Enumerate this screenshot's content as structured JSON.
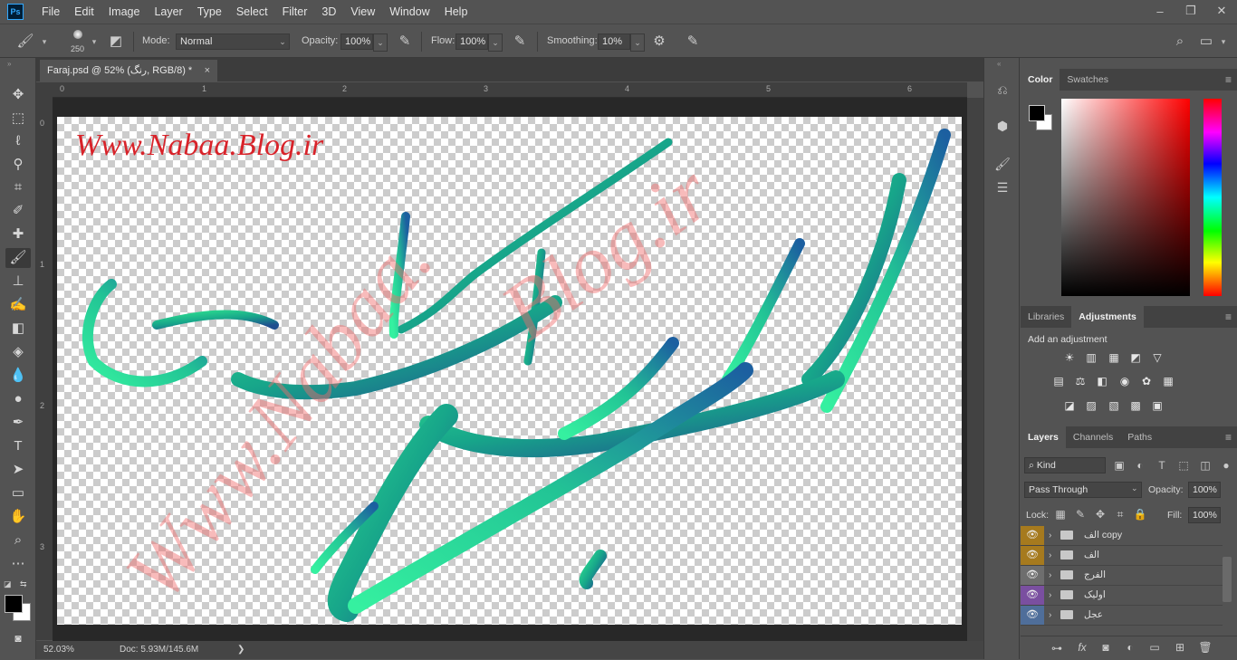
{
  "app": {
    "logo": "Ps"
  },
  "menu": [
    "File",
    "Edit",
    "Image",
    "Layer",
    "Type",
    "Select",
    "Filter",
    "3D",
    "View",
    "Window",
    "Help"
  ],
  "window_controls": {
    "minimize": "–",
    "restore": "❐",
    "close": "✕"
  },
  "options": {
    "brush_size": "250",
    "mode_label": "Mode:",
    "mode_value": "Normal",
    "opacity_label": "Opacity:",
    "opacity_value": "100%",
    "flow_label": "Flow:",
    "flow_value": "100%",
    "smoothing_label": "Smoothing:",
    "smoothing_value": "10%"
  },
  "document": {
    "tab_title": "Faraj.psd @ 52% (رنگ, RGB/8) *",
    "close": "×",
    "ruler_top": [
      "0",
      "1",
      "2",
      "3",
      "4",
      "5",
      "6"
    ],
    "ruler_left": [
      "0",
      "1",
      "2",
      "3"
    ],
    "watermark_top": "Www.Nabaa.Blog.ir",
    "watermark_diag1": "Www.Nabaa.",
    "watermark_diag2": "Blog.ir"
  },
  "status": {
    "zoom": "52.03%",
    "doc_info": "Doc: 5.93M/145.6M",
    "arrow": "❯"
  },
  "color_panel": {
    "tabs": [
      "Color",
      "Swatches"
    ],
    "foreground": "#000000",
    "background": "#ffffff"
  },
  "adjustments_panel": {
    "tabs": [
      "Libraries",
      "Adjustments"
    ],
    "heading": "Add an adjustment"
  },
  "layers_panel": {
    "tabs": [
      "Layers",
      "Channels",
      "Paths"
    ],
    "filter_kind": "Kind",
    "blend_mode": "Pass Through",
    "opacity_label": "Opacity:",
    "opacity_value": "100%",
    "lock_label": "Lock:",
    "fill_label": "Fill:",
    "fill_value": "100%",
    "layers": [
      {
        "name": "الف copy",
        "color": "#a67a1e"
      },
      {
        "name": "الف",
        "color": "#a67a1e"
      },
      {
        "name": "الفرج",
        "color": "#6e6e6e"
      },
      {
        "name": "اولیک",
        "color": "#7a4fa0"
      },
      {
        "name": "عجل",
        "color": "#4f6e9a"
      }
    ]
  }
}
